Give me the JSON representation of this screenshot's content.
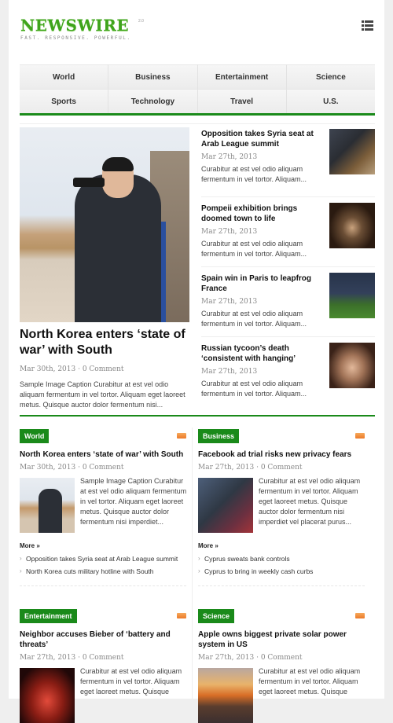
{
  "brand": {
    "name": "NEWSWIRE",
    "version": "2.0",
    "tagline": "FAST. RESPONSIVE. POWERFUL."
  },
  "colors": {
    "accent": "#1a8a1a",
    "logo": "#3fa41c",
    "rss": "#ec7a2a"
  },
  "header": {
    "menu_icon": "list-menu-icon"
  },
  "nav": {
    "row1": [
      "World",
      "Business",
      "Entertainment",
      "Science"
    ],
    "row2": [
      "Sports",
      "Technology",
      "Travel",
      "U.S."
    ]
  },
  "feature": {
    "title": "North Korea enters ‘state of war’ with South",
    "meta": "Mar 30th, 2013 · 0 Comment",
    "excerpt": "Sample Image Caption Curabitur at est vel odio aliquam fermentum in vel tortor. Aliquam eget laoreet metus. Quisque auctor dolor fermentum nisi..."
  },
  "side_stories": [
    {
      "title": "Opposition takes Syria seat at Arab League summit",
      "meta": "Mar 27th, 2013",
      "excerpt": "Curabitur at est vel odio aliquam fermentum in vel tortor. Aliquam..."
    },
    {
      "title": "Pompeii exhibition brings doomed town to life",
      "meta": "Mar 27th, 2013",
      "excerpt": "Curabitur at est vel odio aliquam fermentum in vel tortor. Aliquam..."
    },
    {
      "title": "Spain win in Paris to leapfrog France",
      "meta": "Mar 27th, 2013",
      "excerpt": "Curabitur at est vel odio aliquam fermentum in vel tortor. Aliquam..."
    },
    {
      "title": "Russian tycoon’s death ‘consistent with hanging’",
      "meta": "Mar 27th, 2013",
      "excerpt": "Curabitur at est vel odio aliquam fermentum in vel tortor. Aliquam..."
    }
  ],
  "sections": {
    "world": {
      "category": "World",
      "title": "North Korea enters ‘state of war’ with South",
      "meta": "Mar 30th, 2013 · 0 Comment",
      "excerpt": "Sample Image Caption Curabitur at est vel odio aliquam fermentum in vel tortor. Aliquam eget laoreet metus. Quisque auctor dolor fermentum nisi imperdiet...",
      "more": "More »",
      "links": [
        "Opposition takes Syria seat at Arab League summit",
        "North Korea cuts military hotline with South"
      ]
    },
    "business": {
      "category": "Business",
      "title": "Facebook ad trial risks new privacy fears",
      "meta": "Mar 27th, 2013 · 0 Comment",
      "excerpt": "Curabitur at est vel odio aliquam fermentum in vel tortor. Aliquam eget laoreet metus. Quisque auctor dolor fermentum nisi imperdiet vel placerat purus...",
      "more": "More »",
      "links": [
        "Cyprus sweats bank controls",
        "Cyprus to bring in weekly cash curbs"
      ]
    },
    "entertainment": {
      "category": "Entertainment",
      "title": "Neighbor accuses Bieber of ‘battery and threats’",
      "meta": "Mar 27th, 2013 · 0 Comment",
      "excerpt": "Curabitur at est vel odio aliquam fermentum in vel tortor. Aliquam eget laoreet metus. Quisque"
    },
    "science": {
      "category": "Science",
      "title": "Apple owns biggest private solar power system in US",
      "meta": "Mar 27th, 2013 · 0 Comment",
      "excerpt": "Curabitur at est vel odio aliquam fermentum in vel tortor. Aliquam eget laoreet metus. Quisque"
    }
  }
}
